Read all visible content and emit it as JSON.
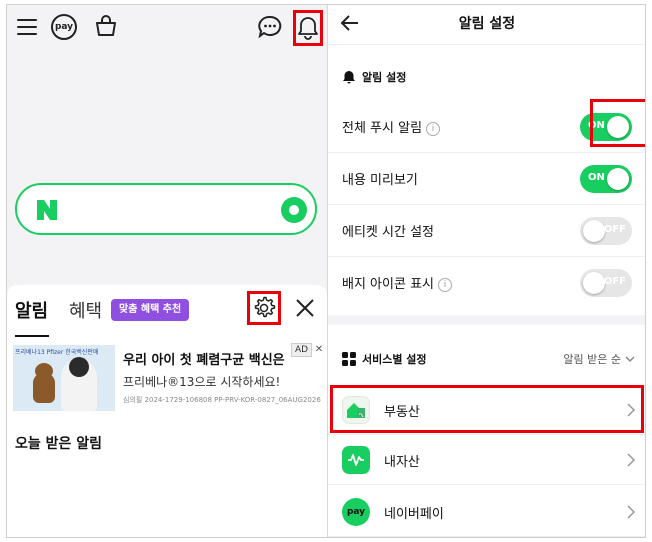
{
  "left": {
    "top_icons": [
      "menu-icon",
      "pay-icon",
      "shopping-bag-icon",
      "chat-icon",
      "bell-icon"
    ],
    "pay_icon_text": "pay",
    "sheet": {
      "tab_alarm": "알림",
      "tab_benefit": "혜택",
      "promo_badge": "맞춤 혜택 추천",
      "ad": {
        "logo_strip": "프리베나13 Pfizer 한국백신판매",
        "title": "우리 아이 첫 폐렴구균 백신은",
        "subtitle": "프리베나®13으로 시작하세요!",
        "fineprint": "심의필 2024-1729-106808 PP-PRV-KOR-0827_06AUG2026",
        "badge": "AD",
        "close": "✕"
      },
      "today_title": "오늘 받은 알림"
    }
  },
  "right": {
    "title": "알림 설정",
    "section1_title": "알림 설정",
    "rows": [
      {
        "label": "전체 푸시 알림",
        "info": true,
        "state": "ON"
      },
      {
        "label": "내용 미리보기",
        "info": false,
        "state": "ON"
      },
      {
        "label": "에티켓 시간 설정",
        "info": false,
        "state": "OFF"
      },
      {
        "label": "배지 아이콘 표시",
        "info": true,
        "state": "OFF"
      }
    ],
    "section2_title": "서비스별 설정",
    "sort_label": "알림 받은 순",
    "services": [
      {
        "label": "부동산",
        "icon": "real-estate-icon"
      },
      {
        "label": "내자산",
        "icon": "my-assets-icon"
      },
      {
        "label": "네이버페이",
        "icon": "naver-pay-icon",
        "icon_text": "pay"
      }
    ]
  },
  "colors": {
    "naver_green": "#19ce60",
    "highlight_red": "#e8000b",
    "promo_purple": "#8f4fe0"
  }
}
